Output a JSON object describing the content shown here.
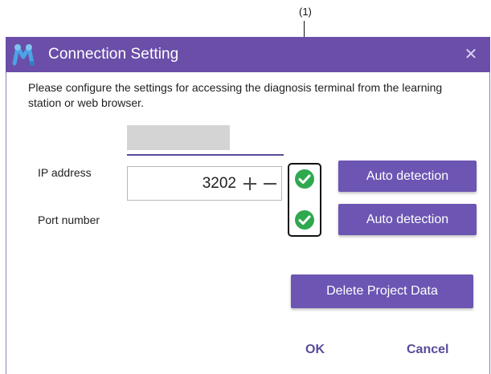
{
  "annotation": {
    "callout": "(1)"
  },
  "window": {
    "title": "Connection Setting",
    "close_glyph": "✕"
  },
  "description": "Please configure the settings for accessing the diagnosis terminal from the learning station or web browser.",
  "ip": {
    "label": "IP address",
    "value": "",
    "status_icon": "check-circle-icon",
    "button_label": "Auto detection"
  },
  "port": {
    "label": "Port number",
    "value": "3202",
    "status_icon": "check-circle-icon",
    "button_label": "Auto detection"
  },
  "actions": {
    "delete_label": "Delete Project Data",
    "ok_label": "OK",
    "cancel_label": "Cancel"
  },
  "colors": {
    "accent": "#6c55b3",
    "titlebar": "#6a4ea8",
    "check": "#2fa84f"
  }
}
